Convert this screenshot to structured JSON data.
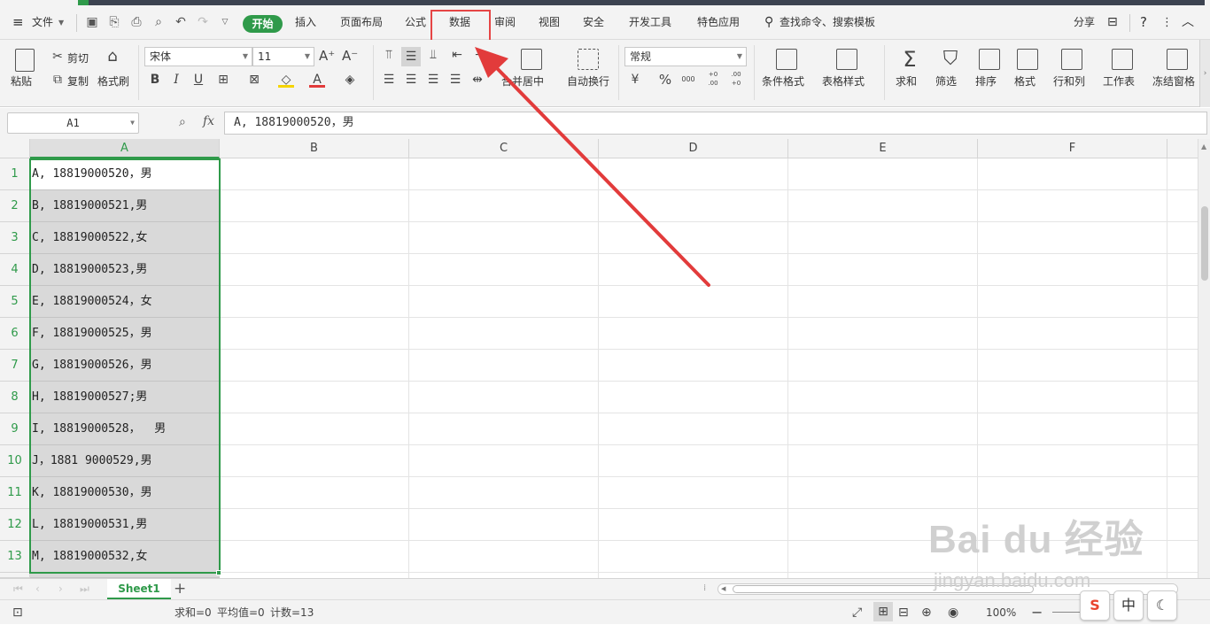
{
  "menubar": {
    "file_label": "文件",
    "tabs": [
      "开始",
      "插入",
      "页面布局",
      "公式",
      "数据",
      "审阅",
      "视图",
      "安全",
      "开发工具",
      "特色应用"
    ],
    "search_label": "查找命令、搜索模板",
    "share_label": "分享",
    "help_label": "?"
  },
  "ribbon": {
    "paste": "粘贴",
    "cut": "剪切",
    "copy": "复制",
    "format_painter": "格式刷",
    "font_name": "宋体",
    "font_size": "11",
    "merge_center": "合并居中",
    "wrap_text": "自动换行",
    "number_format": "常规",
    "conditional_format": "条件格式",
    "table_style": "表格样式",
    "sum": "求和",
    "filter": "筛选",
    "sort": "排序",
    "format": "格式",
    "row_col": "行和列",
    "worksheet": "工作表",
    "freeze": "冻结窗格",
    "currency_symbol": "¥",
    "percent_symbol": "%",
    "thousands_symbol": "000",
    "inc_decimal": "+0 .00",
    "dec_decimal": ".00 +0"
  },
  "formulabar": {
    "cell_ref": "A1",
    "fx": "fx",
    "content": "A, 18819000520，男"
  },
  "grid": {
    "columns": [
      "A",
      "B",
      "C",
      "D",
      "E",
      "F"
    ],
    "rows": [
      {
        "num": "1",
        "value": "A, 18819000520，男"
      },
      {
        "num": "2",
        "value": "B, 18819000521,男"
      },
      {
        "num": "3",
        "value": "C, 18819000522,女"
      },
      {
        "num": "4",
        "value": "D, 18819000523,男"
      },
      {
        "num": "5",
        "value": "E, 18819000524，女"
      },
      {
        "num": "6",
        "value": "F, 18819000525，男"
      },
      {
        "num": "7",
        "value": "G, 18819000526，男"
      },
      {
        "num": "8",
        "value": "H, 18819000527;男"
      },
      {
        "num": "9",
        "value": "I, 18819000528，  男"
      },
      {
        "num": "10",
        "value": "J，1881 9000529,男"
      },
      {
        "num": "11",
        "value": "K, 18819000530，男"
      },
      {
        "num": "12",
        "value": "L, 18819000531,男"
      },
      {
        "num": "13",
        "value": "M, 18819000532,女"
      }
    ]
  },
  "sheetbar": {
    "sheet_name": "Sheet1",
    "add": "+"
  },
  "statusbar": {
    "sum": "求和=0",
    "average": "平均值=0",
    "count": "计数=13",
    "zoom": "100%"
  },
  "ime": {
    "logo": "S",
    "lang": "中"
  },
  "watermark": {
    "logo": "Bai du 经验",
    "url": "jingyan.baidu.com"
  },
  "colors": {
    "accent_green": "#2f9a4a",
    "highlight_red": "#e64545"
  }
}
